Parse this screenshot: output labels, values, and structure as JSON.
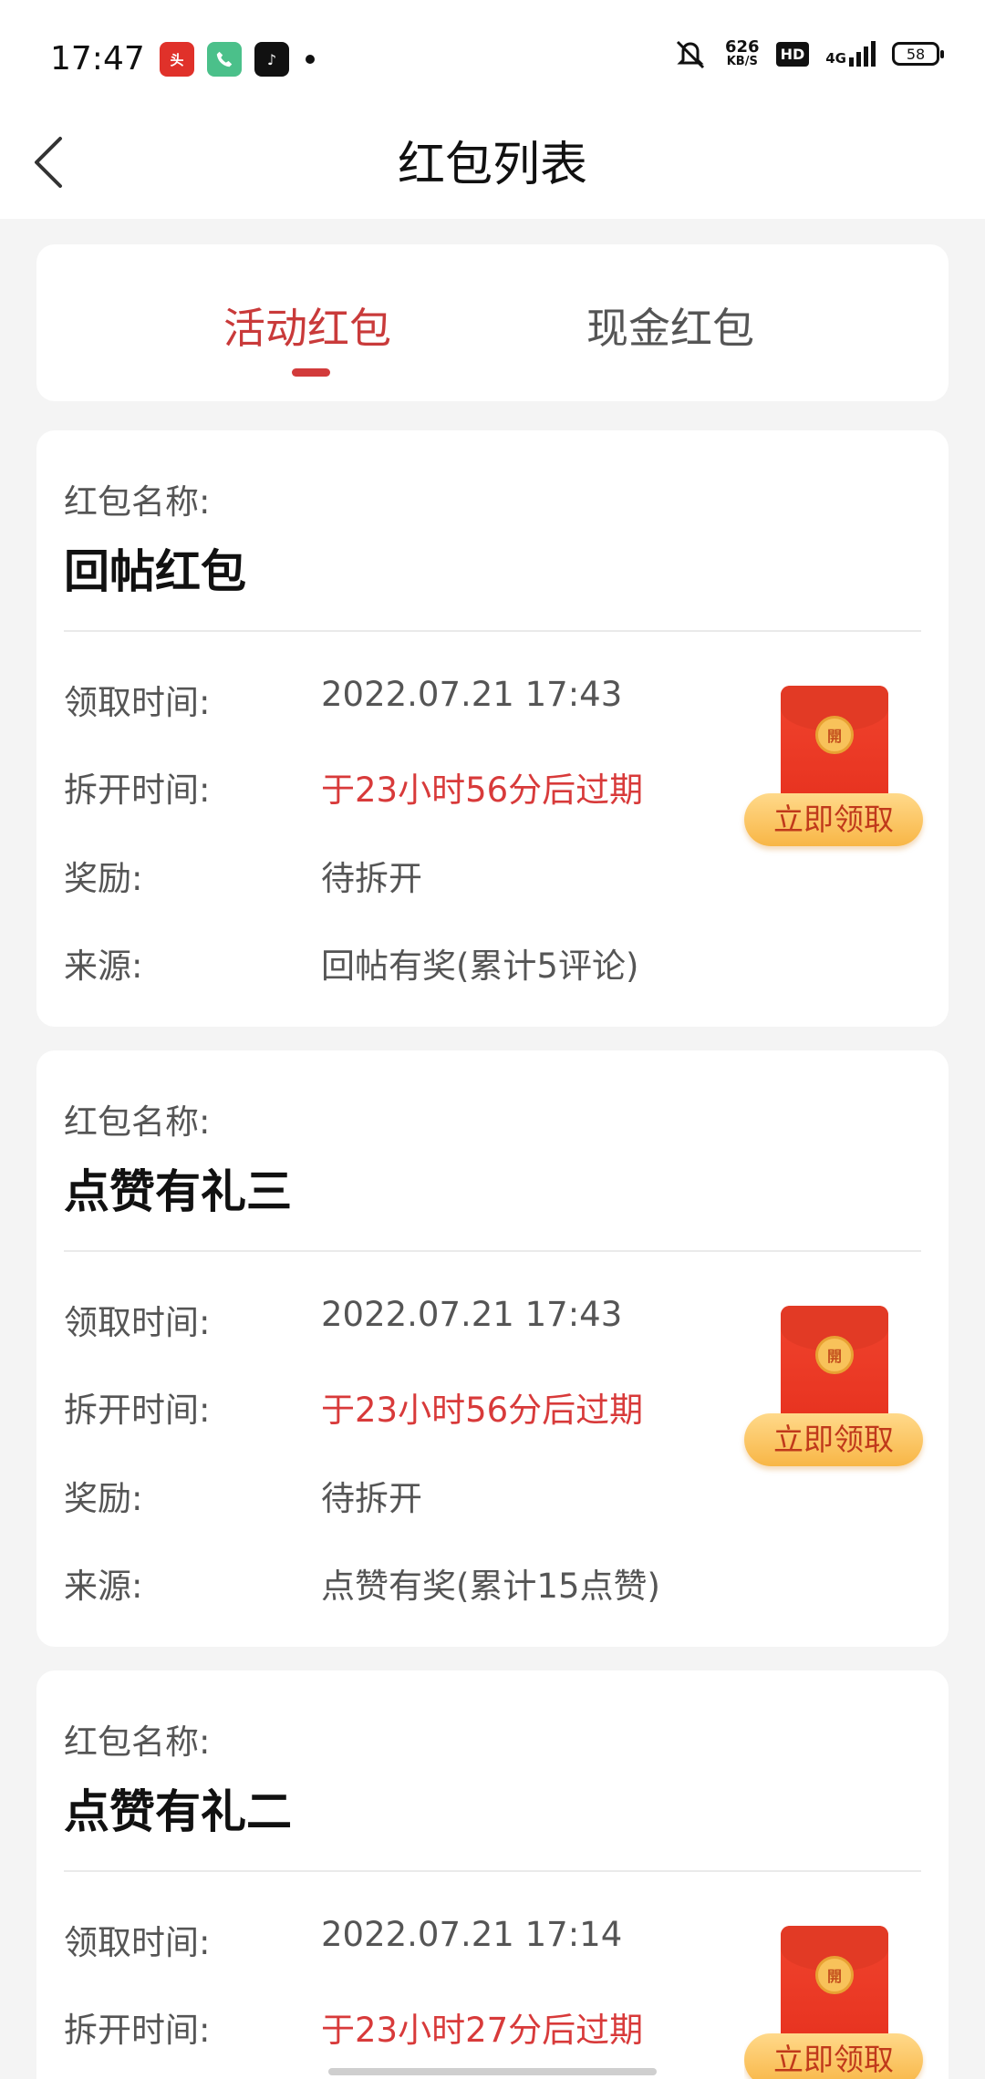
{
  "status_bar": {
    "time": "17:47",
    "net_speed_value": "626",
    "net_speed_unit": "KB/S",
    "hd_label": "HD",
    "network_label": "4G",
    "battery_level": "58",
    "app_icons": [
      "toutiao-icon",
      "phone-icon",
      "tiktok-icon"
    ]
  },
  "header": {
    "title": "红包列表",
    "back_icon": "chevron-left-icon"
  },
  "tabs": [
    {
      "label": "活动红包",
      "active": true
    },
    {
      "label": "现金红包",
      "active": false
    }
  ],
  "labels": {
    "name": "红包名称:",
    "receive_time": "领取时间:",
    "open_time": "拆开时间:",
    "reward": "奖励:",
    "source": "来源:",
    "claim_button": "立即领取",
    "seal_char": "開"
  },
  "packets": [
    {
      "name": "回帖红包",
      "receive_time": "2022.07.21 17:43",
      "open_time": "于23小时56分后过期",
      "reward": "待拆开",
      "source": "回帖有奖(累计5评论)"
    },
    {
      "name": "点赞有礼三",
      "receive_time": "2022.07.21 17:43",
      "open_time": "于23小时56分后过期",
      "reward": "待拆开",
      "source": "点赞有奖(累计15点赞)"
    },
    {
      "name": "点赞有礼二",
      "receive_time": "2022.07.21 17:14",
      "open_time": "于23小时27分后过期",
      "reward": "",
      "source": ""
    }
  ],
  "colors": {
    "accent_red": "#d83a3a",
    "tab_active": "#c93a3a",
    "background": "#f4f4f4"
  }
}
